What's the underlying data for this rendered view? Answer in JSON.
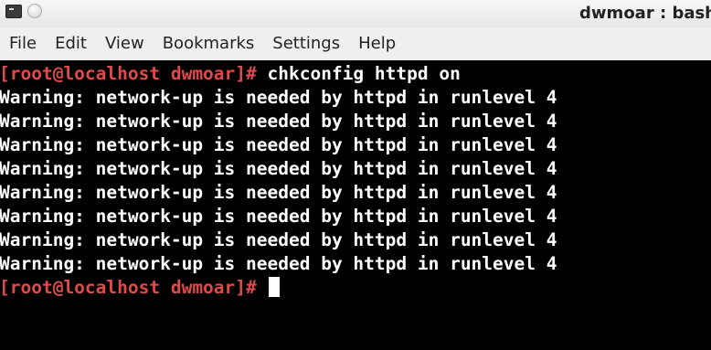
{
  "window": {
    "title": "dwmoar : bash"
  },
  "menu": {
    "items": [
      "File",
      "Edit",
      "View",
      "Bookmarks",
      "Settings",
      "Help"
    ]
  },
  "terminal": {
    "prompt": "[root@localhost dwmoar]#",
    "command": " chkconfig httpd on",
    "output_lines": [
      "Warning: network-up is needed by httpd in runlevel 4",
      "Warning: network-up is needed by httpd in runlevel 4",
      "Warning: network-up is needed by httpd in runlevel 4",
      "Warning: network-up is needed by httpd in runlevel 4",
      "Warning: network-up is needed by httpd in runlevel 4",
      "Warning: network-up is needed by httpd in runlevel 4",
      "Warning: network-up is needed by httpd in runlevel 4",
      "Warning: network-up is needed by httpd in runlevel 4"
    ],
    "final_prompt": "[root@localhost dwmoar]#"
  },
  "colors": {
    "background": "#000000",
    "prompt": "#e04a4a",
    "text": "#ffffff"
  },
  "icons": {
    "app": "terminal-icon",
    "window_button": "window-circle-button-icon"
  }
}
